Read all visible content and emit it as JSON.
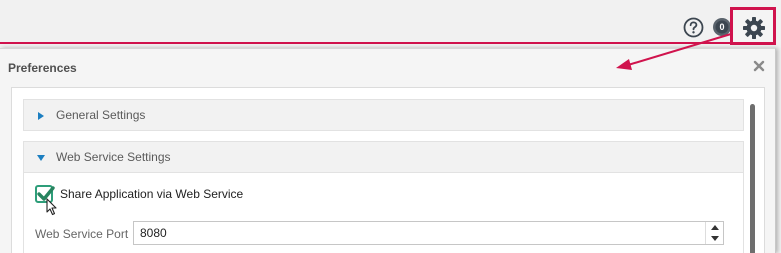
{
  "topbar": {
    "help_icon": "help-icon",
    "notifications": {
      "icon": "notification-badge-icon",
      "count": "0"
    },
    "settings_icon": "gear-icon"
  },
  "colors": {
    "accent": "#d0134d",
    "icon_dark": "#3c4650",
    "section_triangle": "#1c7fc1",
    "checkbox_border": "#2e9e7a",
    "checkbox_check": "#27845f"
  },
  "dialog": {
    "title": "Preferences",
    "close_icon": "close-icon",
    "sections": [
      {
        "label": "General Settings",
        "expanded": false
      },
      {
        "label": "Web Service Settings",
        "expanded": true
      }
    ],
    "web_service": {
      "share_checkbox": {
        "label": "Share Application via Web Service",
        "checked": true
      },
      "port": {
        "label": "Web Service Port",
        "value": "8080"
      }
    }
  }
}
